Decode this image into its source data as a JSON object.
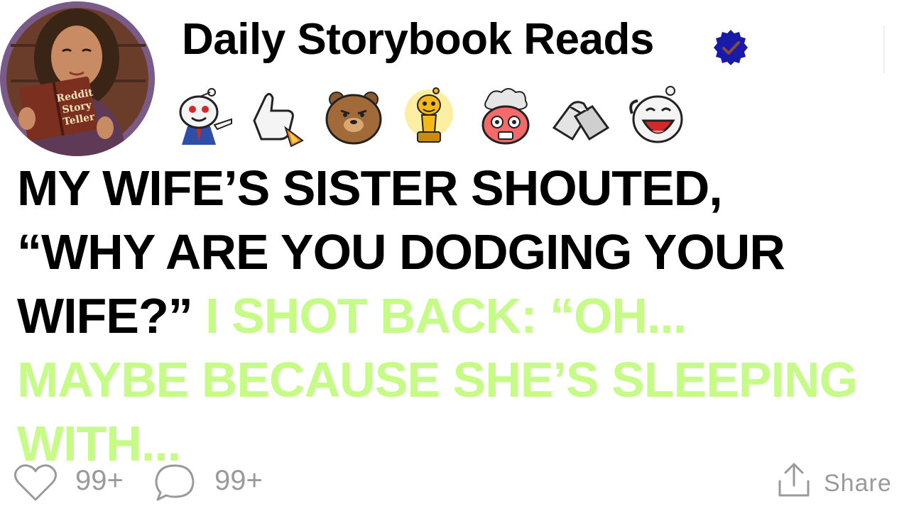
{
  "header": {
    "channel_name": "Daily Storybook Reads",
    "verified": true,
    "avatar_book_text": [
      "Reddit",
      "Story",
      "Teller"
    ]
  },
  "awards": [
    {
      "name": "pointing-snoo-award"
    },
    {
      "name": "rocket-thumbs-up-award"
    },
    {
      "name": "bear-award"
    },
    {
      "name": "gold-trophy-award"
    },
    {
      "name": "mind-blown-award"
    },
    {
      "name": "handshake-award"
    },
    {
      "name": "laughing-snoo-award"
    }
  ],
  "headline": {
    "black_line_1": "MY WIFE’S SISTER SHOUTED,",
    "black_line_2": "“WHY ARE YOU DODGING YOUR",
    "black_line_3": "WIFE?”",
    "green_line_3": "I SHOT BACK: “OH...",
    "green_line_4": "MAYBE BECAUSE SHE’S SLEEPING",
    "green_line_5": "WITH..."
  },
  "actions": {
    "likes": "99+",
    "comments": "99+",
    "share": "Share"
  },
  "colors": {
    "highlight": "#c7fb88",
    "text": "#000000",
    "muted": "#9a9a9a",
    "verified_badge": "#1a1aa8"
  }
}
